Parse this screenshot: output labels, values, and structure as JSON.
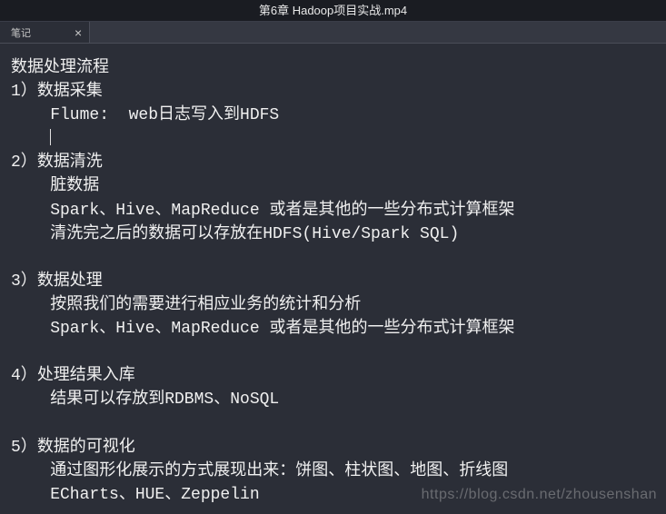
{
  "titlebar": {
    "filename": "第6章 Hadoop项目实战.mp4"
  },
  "tab": {
    "label": "笔记",
    "close": "×"
  },
  "note": {
    "heading": "数据处理流程",
    "s1_num": "1）",
    "s1_title": "数据采集",
    "s1_l1": "    Flume:  web日志写入到HDFS",
    "s2_num": "2）",
    "s2_title": "数据清洗",
    "s2_l1": "    脏数据",
    "s2_l2": "    Spark、Hive、MapReduce 或者是其他的一些分布式计算框架",
    "s2_l3": "    清洗完之后的数据可以存放在HDFS(Hive/Spark SQL)",
    "s3_num": "3）",
    "s3_title": "数据处理",
    "s3_l1": "    按照我们的需要进行相应业务的统计和分析",
    "s3_l2": "    Spark、Hive、MapReduce 或者是其他的一些分布式计算框架",
    "s4_num": "4）",
    "s4_title": "处理结果入库",
    "s4_l1": "    结果可以存放到RDBMS、NoSQL",
    "s5_num": "5）",
    "s5_title": "数据的可视化",
    "s5_l1": "    通过图形化展示的方式展现出来：饼图、柱状图、地图、折线图",
    "s5_l2": "    ECharts、HUE、Zeppelin"
  },
  "watermark": "https://blog.csdn.net/zhousenshan"
}
